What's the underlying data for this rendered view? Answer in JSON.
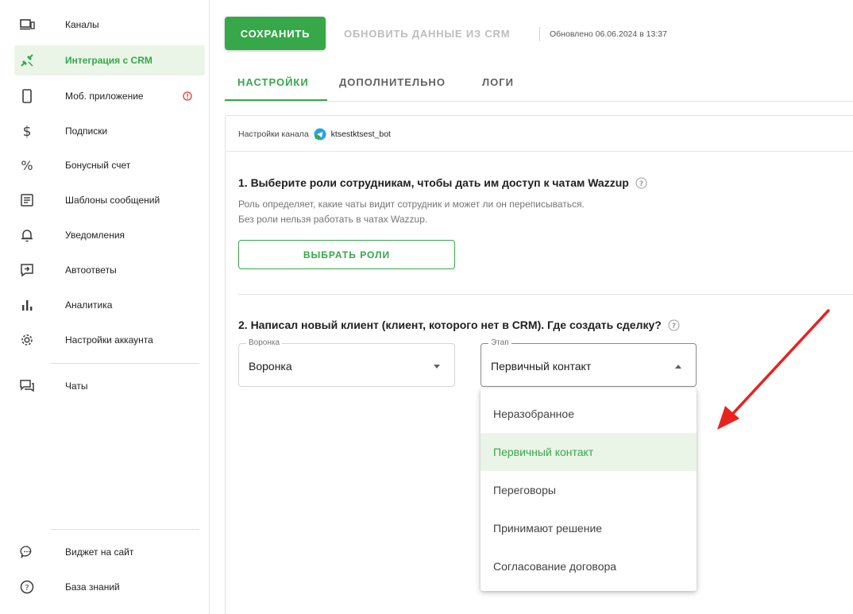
{
  "sidebar": {
    "items": [
      {
        "label": "Каналы",
        "icon": "devices-icon"
      },
      {
        "label": "Интеграция с CRM",
        "icon": "plug-icon",
        "active": true
      },
      {
        "label": "Моб. приложение",
        "icon": "phone-icon",
        "badge": "alert-icon"
      },
      {
        "label": "Подписки",
        "icon": "dollar-icon"
      },
      {
        "label": "Бонусный счет",
        "icon": "percent-icon"
      },
      {
        "label": "Шаблоны сообщений",
        "icon": "template-icon"
      },
      {
        "label": "Уведомления",
        "icon": "bell-icon"
      },
      {
        "label": "Автоответы",
        "icon": "autoreply-icon"
      },
      {
        "label": "Аналитика",
        "icon": "analytics-icon"
      },
      {
        "label": "Настройки аккаунта",
        "icon": "gear-icon"
      },
      {
        "label": "Чаты",
        "icon": "chats-icon"
      },
      {
        "label": "Виджет на сайт",
        "icon": "widget-icon"
      },
      {
        "label": "База знаний",
        "icon": "help-icon"
      }
    ]
  },
  "toolbar": {
    "save_label": "СОХРАНИТЬ",
    "update_label": "ОБНОВИТЬ ДАННЫЕ ИЗ CRM",
    "updated_text": "Обновлено 06.06.2024 в 13:37"
  },
  "tabs": [
    {
      "label": "НАСТРОЙКИ",
      "active": true
    },
    {
      "label": "ДОПОЛНИТЕЛЬНО"
    },
    {
      "label": "ЛОГИ"
    }
  ],
  "channel": {
    "label": "Настройки канала",
    "bot_name": "ktsestktsest_bot",
    "icon": "telegram-icon"
  },
  "section1": {
    "title": "1. Выберите роли сотрудникам, чтобы дать им доступ к чатам Wazzup",
    "desc_line1": "Роль определяет, какие чаты видит сотрудник и может ли он переписываться.",
    "desc_line2": "Без роли нельзя работать в чатах Wazzup.",
    "button_label": "ВЫБРАТЬ РОЛИ"
  },
  "section2": {
    "title": "2. Написал новый клиент (клиент, которого нет в CRM). Где создать сделку?",
    "funnel": {
      "legend": "Воронка",
      "value": "Воронка"
    },
    "stage": {
      "legend": "Этап",
      "value": "Первичный контакт",
      "options": [
        "Неразобранное",
        "Первичный контакт",
        "Переговоры",
        "Принимают решение",
        "Согласование договора"
      ],
      "selected_index": 1
    }
  },
  "colors": {
    "accent": "#36a84a",
    "accent_light": "#eaf5e7",
    "alert": "#e53935",
    "annotation_arrow": "#e8231f"
  }
}
